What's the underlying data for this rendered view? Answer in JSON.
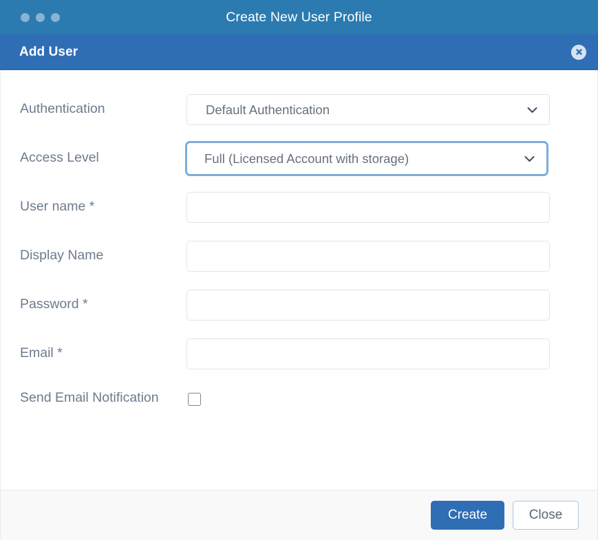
{
  "window": {
    "title": "Create New User Profile",
    "traffic_light_count": 3,
    "titlebar_color": "#2b7bb0"
  },
  "dialog": {
    "header_title": "Add User",
    "header_color": "#2f6eb5",
    "close_icon": "close-circle-icon"
  },
  "form": {
    "fields": [
      {
        "label": "Authentication",
        "type": "select",
        "value": "Default Authentication",
        "focused": false,
        "icon": "chevron-down-icon"
      },
      {
        "label": "Access Level",
        "type": "select",
        "value": "Full (Licensed Account with storage)",
        "focused": true,
        "icon": "chevron-down-icon"
      },
      {
        "label": "User name *",
        "type": "text",
        "value": "",
        "placeholder": ""
      },
      {
        "label": "Display Name",
        "type": "text",
        "value": "",
        "placeholder": ""
      },
      {
        "label": "Password *",
        "type": "password",
        "value": "",
        "placeholder": ""
      },
      {
        "label": "Email *",
        "type": "text",
        "value": "",
        "placeholder": ""
      },
      {
        "label": "Send Email Notification",
        "type": "checkbox",
        "checked": false
      }
    ]
  },
  "footer": {
    "create_label": "Create",
    "close_label": "Close",
    "primary_color": "#2f6eb5",
    "secondary_border_color": "#a9c5e3"
  }
}
